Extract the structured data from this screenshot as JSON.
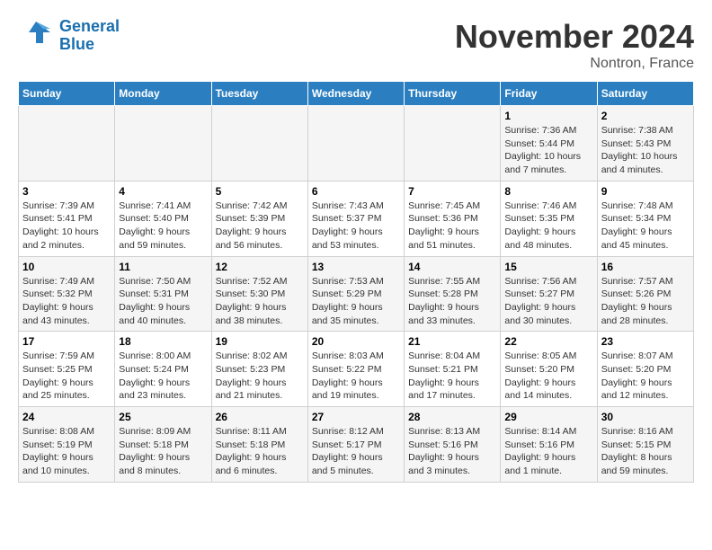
{
  "logo": {
    "line1": "General",
    "line2": "Blue"
  },
  "title": "November 2024",
  "location": "Nontron, France",
  "days_of_week": [
    "Sunday",
    "Monday",
    "Tuesday",
    "Wednesday",
    "Thursday",
    "Friday",
    "Saturday"
  ],
  "weeks": [
    [
      {
        "day": "",
        "info": ""
      },
      {
        "day": "",
        "info": ""
      },
      {
        "day": "",
        "info": ""
      },
      {
        "day": "",
        "info": ""
      },
      {
        "day": "",
        "info": ""
      },
      {
        "day": "1",
        "info": "Sunrise: 7:36 AM\nSunset: 5:44 PM\nDaylight: 10 hours and 7 minutes."
      },
      {
        "day": "2",
        "info": "Sunrise: 7:38 AM\nSunset: 5:43 PM\nDaylight: 10 hours and 4 minutes."
      }
    ],
    [
      {
        "day": "3",
        "info": "Sunrise: 7:39 AM\nSunset: 5:41 PM\nDaylight: 10 hours and 2 minutes."
      },
      {
        "day": "4",
        "info": "Sunrise: 7:41 AM\nSunset: 5:40 PM\nDaylight: 9 hours and 59 minutes."
      },
      {
        "day": "5",
        "info": "Sunrise: 7:42 AM\nSunset: 5:39 PM\nDaylight: 9 hours and 56 minutes."
      },
      {
        "day": "6",
        "info": "Sunrise: 7:43 AM\nSunset: 5:37 PM\nDaylight: 9 hours and 53 minutes."
      },
      {
        "day": "7",
        "info": "Sunrise: 7:45 AM\nSunset: 5:36 PM\nDaylight: 9 hours and 51 minutes."
      },
      {
        "day": "8",
        "info": "Sunrise: 7:46 AM\nSunset: 5:35 PM\nDaylight: 9 hours and 48 minutes."
      },
      {
        "day": "9",
        "info": "Sunrise: 7:48 AM\nSunset: 5:34 PM\nDaylight: 9 hours and 45 minutes."
      }
    ],
    [
      {
        "day": "10",
        "info": "Sunrise: 7:49 AM\nSunset: 5:32 PM\nDaylight: 9 hours and 43 minutes."
      },
      {
        "day": "11",
        "info": "Sunrise: 7:50 AM\nSunset: 5:31 PM\nDaylight: 9 hours and 40 minutes."
      },
      {
        "day": "12",
        "info": "Sunrise: 7:52 AM\nSunset: 5:30 PM\nDaylight: 9 hours and 38 minutes."
      },
      {
        "day": "13",
        "info": "Sunrise: 7:53 AM\nSunset: 5:29 PM\nDaylight: 9 hours and 35 minutes."
      },
      {
        "day": "14",
        "info": "Sunrise: 7:55 AM\nSunset: 5:28 PM\nDaylight: 9 hours and 33 minutes."
      },
      {
        "day": "15",
        "info": "Sunrise: 7:56 AM\nSunset: 5:27 PM\nDaylight: 9 hours and 30 minutes."
      },
      {
        "day": "16",
        "info": "Sunrise: 7:57 AM\nSunset: 5:26 PM\nDaylight: 9 hours and 28 minutes."
      }
    ],
    [
      {
        "day": "17",
        "info": "Sunrise: 7:59 AM\nSunset: 5:25 PM\nDaylight: 9 hours and 25 minutes."
      },
      {
        "day": "18",
        "info": "Sunrise: 8:00 AM\nSunset: 5:24 PM\nDaylight: 9 hours and 23 minutes."
      },
      {
        "day": "19",
        "info": "Sunrise: 8:02 AM\nSunset: 5:23 PM\nDaylight: 9 hours and 21 minutes."
      },
      {
        "day": "20",
        "info": "Sunrise: 8:03 AM\nSunset: 5:22 PM\nDaylight: 9 hours and 19 minutes."
      },
      {
        "day": "21",
        "info": "Sunrise: 8:04 AM\nSunset: 5:21 PM\nDaylight: 9 hours and 17 minutes."
      },
      {
        "day": "22",
        "info": "Sunrise: 8:05 AM\nSunset: 5:20 PM\nDaylight: 9 hours and 14 minutes."
      },
      {
        "day": "23",
        "info": "Sunrise: 8:07 AM\nSunset: 5:20 PM\nDaylight: 9 hours and 12 minutes."
      }
    ],
    [
      {
        "day": "24",
        "info": "Sunrise: 8:08 AM\nSunset: 5:19 PM\nDaylight: 9 hours and 10 minutes."
      },
      {
        "day": "25",
        "info": "Sunrise: 8:09 AM\nSunset: 5:18 PM\nDaylight: 9 hours and 8 minutes."
      },
      {
        "day": "26",
        "info": "Sunrise: 8:11 AM\nSunset: 5:18 PM\nDaylight: 9 hours and 6 minutes."
      },
      {
        "day": "27",
        "info": "Sunrise: 8:12 AM\nSunset: 5:17 PM\nDaylight: 9 hours and 5 minutes."
      },
      {
        "day": "28",
        "info": "Sunrise: 8:13 AM\nSunset: 5:16 PM\nDaylight: 9 hours and 3 minutes."
      },
      {
        "day": "29",
        "info": "Sunrise: 8:14 AM\nSunset: 5:16 PM\nDaylight: 9 hours and 1 minute."
      },
      {
        "day": "30",
        "info": "Sunrise: 8:16 AM\nSunset: 5:15 PM\nDaylight: 8 hours and 59 minutes."
      }
    ]
  ]
}
